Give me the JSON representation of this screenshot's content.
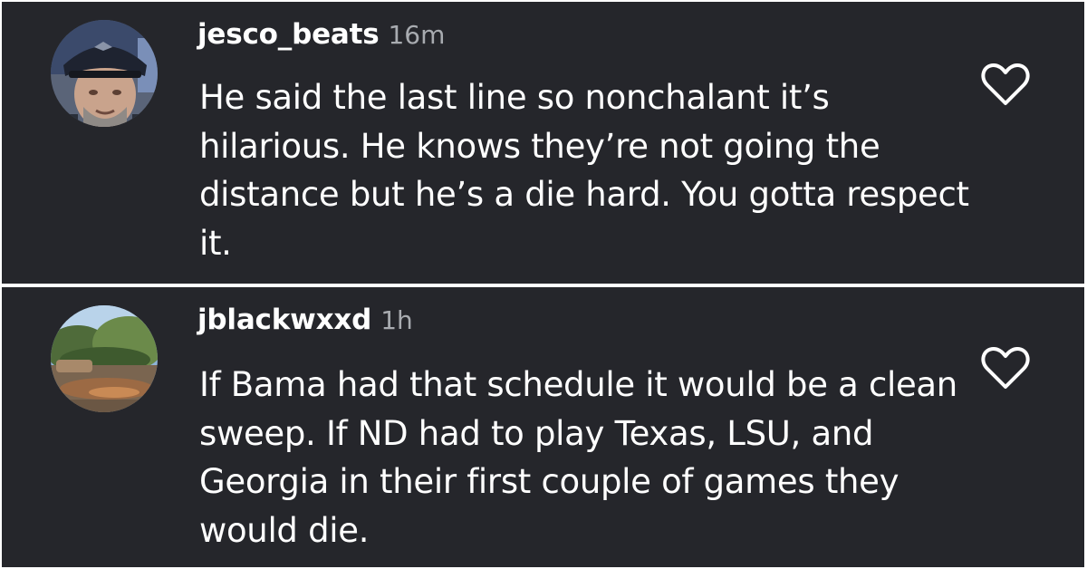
{
  "comments": [
    {
      "username": "jesco_beats",
      "timestamp": "16m",
      "text": "He said the last line so nonchalant it’s hilarious. He knows they’re not going the distance but he’s a die hard. You gotta respect it.",
      "avatar_icon": "user-photo-man-in-cap-icon",
      "like_icon": "heart-outline-icon"
    },
    {
      "username": "jblackwxxd",
      "timestamp": "1h",
      "text": "If Bama had that schedule it would be a clean sweep. If ND had to play Texas, LSU, and Georgia in their first couple of games they would die.",
      "avatar_icon": "landscape-photo-icon",
      "like_icon": "heart-outline-icon"
    }
  ],
  "colors": {
    "background": "#25262b",
    "text": "#ffffff",
    "timestamp": "#a8abb0",
    "divider": "#ffffff"
  }
}
